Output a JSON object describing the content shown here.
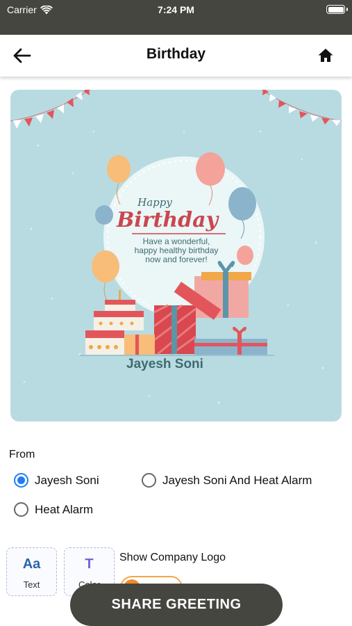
{
  "status_bar": {
    "carrier": "Carrier",
    "time": "7:24 PM",
    "icons": [
      "wifi-icon",
      "battery-icon"
    ]
  },
  "nav": {
    "title": "Birthday",
    "back_icon": "arrow-left-icon",
    "home_icon": "home-icon"
  },
  "greeting_card": {
    "header_script": "Happy",
    "title": "Birthday",
    "message_lines": [
      "Have a wonderful,",
      "happy healthy birthday",
      "now and forever!"
    ],
    "name": "Jayesh Soni",
    "colors": {
      "background": "#b8dbe2",
      "title": "#c9474f",
      "name": "#3e6b6f"
    }
  },
  "from_section": {
    "label": "From",
    "options": [
      {
        "label": "Jayesh Soni",
        "selected": true
      },
      {
        "label": "Jayesh Soni And Heat Alarm",
        "selected": false
      },
      {
        "label": "Heat Alarm",
        "selected": false
      }
    ]
  },
  "tools": [
    {
      "icon": "text-style-icon",
      "icon_text": "Aa",
      "label": "Text"
    },
    {
      "icon": "text-color-icon",
      "icon_text": "T",
      "label": "Color"
    }
  ],
  "company_logo": {
    "label": "Show Company Logo",
    "enabled": false
  },
  "share_button": {
    "label": "SHARE GREETING"
  },
  "colors": {
    "bar": "#44463f",
    "accent_radio": "#1f7cf5",
    "toggle": "#f08b2c"
  }
}
